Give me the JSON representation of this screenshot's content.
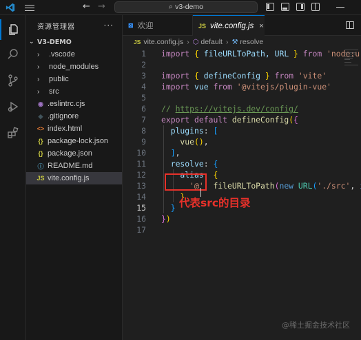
{
  "window": {
    "search_text": "v3-demo"
  },
  "sidebar": {
    "title": "资源管理器",
    "more": "···",
    "project": "V3-DEMO",
    "items": [
      {
        "label": ".vscode",
        "kind": "folder",
        "icon": "chevron-right-icon",
        "chevron": "›",
        "glyph": "",
        "color": "#cccccc"
      },
      {
        "label": "node_modules",
        "kind": "folder",
        "icon": "chevron-right-icon",
        "chevron": "›",
        "glyph": "",
        "color": "#cccccc"
      },
      {
        "label": "public",
        "kind": "folder",
        "icon": "chevron-right-icon",
        "chevron": "›",
        "glyph": "",
        "color": "#cccccc"
      },
      {
        "label": "src",
        "kind": "folder",
        "icon": "chevron-right-icon",
        "chevron": "›",
        "glyph": "",
        "color": "#cccccc"
      },
      {
        "label": ".eslintrc.cjs",
        "kind": "file",
        "icon": "eslint-icon",
        "chevron": "",
        "glyph": "◉",
        "color": "#a074c4"
      },
      {
        "label": ".gitignore",
        "kind": "file",
        "icon": "git-icon",
        "chevron": "",
        "glyph": "◆",
        "color": "#41535b"
      },
      {
        "label": "index.html",
        "kind": "file",
        "icon": "html-icon",
        "chevron": "",
        "glyph": "<>",
        "color": "#e37933"
      },
      {
        "label": "package-lock.json",
        "kind": "file",
        "icon": "json-icon",
        "chevron": "",
        "glyph": "{}",
        "color": "#cbcb41"
      },
      {
        "label": "package.json",
        "kind": "file",
        "icon": "json-icon",
        "chevron": "",
        "glyph": "{}",
        "color": "#cbcb41"
      },
      {
        "label": "README.md",
        "kind": "file",
        "icon": "info-icon",
        "chevron": "",
        "glyph": "ⓘ",
        "color": "#519aba"
      },
      {
        "label": "vite.config.js",
        "kind": "file",
        "icon": "js-icon",
        "chevron": "",
        "glyph": "JS",
        "color": "#cbcb41",
        "selected": true
      }
    ]
  },
  "tabs": [
    {
      "label": "欢迎",
      "icon_glyph": "⊠",
      "icon_color": "#3794ff",
      "active": false
    },
    {
      "label": "vite.config.js",
      "icon_glyph": "JS",
      "icon_color": "#cbcb41",
      "active": true,
      "close": "×"
    }
  ],
  "breadcrumb": {
    "file_icon": "JS",
    "file": "vite.config.js",
    "sep": "›",
    "symbol1": "default",
    "symbol2": "resolve"
  },
  "editor": {
    "current_line": 15,
    "lines": [
      {
        "n": "1",
        "tokens": [
          [
            "import",
            "ctrl"
          ],
          [
            " ",
            "pun"
          ],
          [
            "{",
            "br1"
          ],
          [
            " fileURLToPath, URL ",
            "var"
          ],
          [
            "}",
            "br1"
          ],
          [
            " from ",
            "ctrl"
          ],
          [
            "'node:url'",
            "str"
          ]
        ]
      },
      {
        "n": "2",
        "tokens": []
      },
      {
        "n": "3",
        "tokens": [
          [
            "import",
            "ctrl"
          ],
          [
            " ",
            "pun"
          ],
          [
            "{",
            "br1"
          ],
          [
            " defineConfig ",
            "var"
          ],
          [
            "}",
            "br1"
          ],
          [
            " from ",
            "ctrl"
          ],
          [
            "'vite'",
            "str"
          ]
        ]
      },
      {
        "n": "4",
        "tokens": [
          [
            "import",
            "ctrl"
          ],
          [
            " vue ",
            "var"
          ],
          [
            "from",
            "ctrl"
          ],
          [
            " '@vitejs/plugin-vue'",
            "str"
          ]
        ]
      },
      {
        "n": "5",
        "tokens": []
      },
      {
        "n": "6",
        "tokens": [
          [
            "// ",
            "cm"
          ],
          [
            "https://vitejs.dev/config/",
            "link"
          ]
        ]
      },
      {
        "n": "7",
        "tokens": [
          [
            "export",
            "ctrl"
          ],
          [
            " default ",
            "ctrl"
          ],
          [
            "defineConfig",
            "fn"
          ],
          [
            "(",
            "br1"
          ],
          [
            "{",
            "br2"
          ]
        ]
      },
      {
        "n": "8",
        "tokens": [
          [
            "  plugins",
            "var"
          ],
          [
            ": ",
            "pun"
          ],
          [
            "[",
            "br3"
          ]
        ]
      },
      {
        "n": "9",
        "tokens": [
          [
            "    vue",
            "fn"
          ],
          [
            "(",
            "br1"
          ],
          [
            ")",
            "br1"
          ],
          [
            ",",
            "pun"
          ]
        ]
      },
      {
        "n": "10",
        "tokens": [
          [
            "  ",
            "pun"
          ],
          [
            "]",
            "br3"
          ],
          [
            ",",
            "pun"
          ]
        ]
      },
      {
        "n": "11",
        "tokens": [
          [
            "  resolve",
            "var"
          ],
          [
            ": ",
            "pun"
          ],
          [
            "{",
            "br3"
          ]
        ]
      },
      {
        "n": "12",
        "tokens": [
          [
            "    alias",
            "var"
          ],
          [
            ": ",
            "pun"
          ],
          [
            "{",
            "br1"
          ]
        ]
      },
      {
        "n": "13",
        "tokens": [
          [
            "      ",
            "pun"
          ],
          [
            "'@'",
            "str"
          ],
          [
            ": ",
            "pun"
          ],
          [
            "fileURLToPath",
            "fn"
          ],
          [
            "(",
            "br2"
          ],
          [
            "new ",
            "kw"
          ],
          [
            "URL",
            "cls"
          ],
          [
            "(",
            "br3"
          ],
          [
            "'./src'",
            "str"
          ],
          [
            ", ",
            "pun"
          ],
          [
            "import",
            "kw"
          ]
        ]
      },
      {
        "n": "14",
        "tokens": [
          [
            "    ",
            "pun"
          ],
          [
            "}",
            "br1"
          ]
        ]
      },
      {
        "n": "15",
        "tokens": [
          [
            "  ",
            "pun"
          ],
          [
            "}",
            "br3"
          ]
        ]
      },
      {
        "n": "16",
        "tokens": [
          [
            "}",
            "br2"
          ],
          [
            ")",
            "br1"
          ]
        ]
      },
      {
        "n": "17",
        "tokens": []
      }
    ]
  },
  "annotation": {
    "text": "代表src的目录"
  },
  "watermark": "@稀土掘金技术社区"
}
